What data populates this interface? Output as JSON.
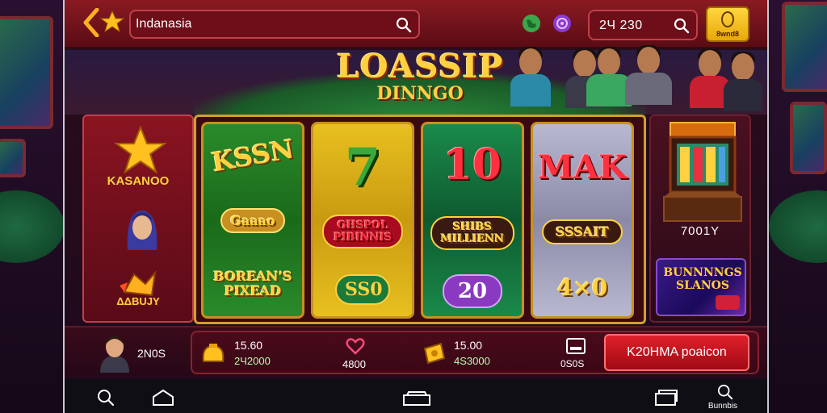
{
  "search": {
    "value": "Indanasia"
  },
  "header": {
    "balance": "2Ч 230",
    "coin_label": "8wnd8"
  },
  "logo": {
    "line1": "LOASSIP",
    "line2": "DINNGO"
  },
  "left_panel": {
    "label_top": "KASANOO",
    "label_bottom": "ΔΔBUJY"
  },
  "reels": [
    {
      "top": "KSSN",
      "middle": "Gaaao",
      "bottom": "BOREAN’S PIXEAD"
    },
    {
      "top": "7",
      "middle": "GHSPOL PIBINNIS",
      "bottom": "SS0"
    },
    {
      "top": "10",
      "middle": "SHIBS MILLIENN",
      "bottom": "20"
    },
    {
      "top": "MAK",
      "middle": "SSSAIT",
      "bottom": "4×0"
    }
  ],
  "right_panel": {
    "label": "7001Y",
    "promo": "BUNNNNGS SLANOS"
  },
  "user": {
    "label": "2N0S"
  },
  "stats": {
    "stat1_value": "15.60",
    "stat1_sub": "2Ч2000",
    "heart_value": "4800",
    "stat2_value": "15.00",
    "stat2_sub": "4S3000",
    "device_value": "0S0S",
    "cta": "K20HMA poaicon"
  },
  "nav": {
    "last_label": "Bunnbis"
  },
  "colors": {
    "accent": "#8a1a22",
    "gold": "#ffd040",
    "cta": "#e0202a"
  }
}
